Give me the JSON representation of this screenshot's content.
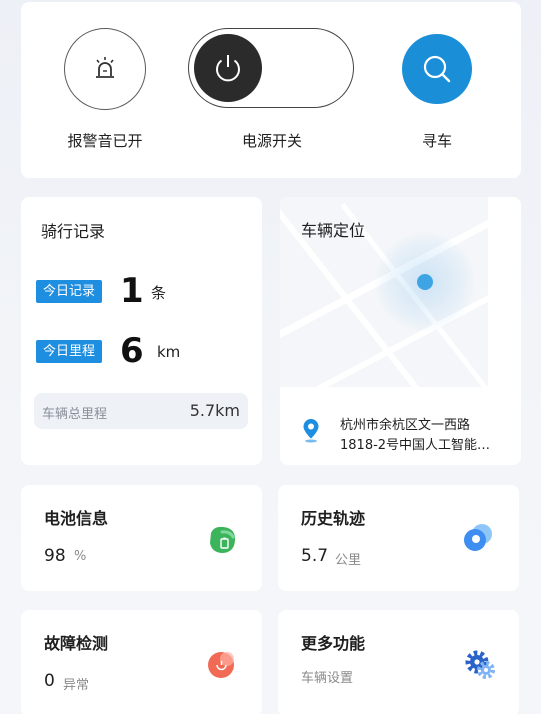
{
  "controls": {
    "alarm_label": "报警音已开",
    "power_label": "电源开关",
    "find_label": "寻车"
  },
  "ride": {
    "title": "骑行记录",
    "today_records_tag": "今日记录",
    "today_records_value": "1",
    "today_records_unit": "条",
    "today_mileage_tag": "今日里程",
    "today_mileage_value": "6",
    "today_mileage_unit": "km",
    "total_label": "车辆总里程",
    "total_value": "5.7km"
  },
  "location": {
    "title": "车辆定位",
    "address_line1": "杭州市余杭区文一西路",
    "address_line2": "1818-2号中国人工智能…"
  },
  "battery": {
    "title": "电池信息",
    "value": "98",
    "unit": "%"
  },
  "history": {
    "title": "历史轨迹",
    "value": "5.7",
    "unit": "公里"
  },
  "fault": {
    "title": "故障检测",
    "value": "0",
    "unit": "异常"
  },
  "more": {
    "title": "更多功能",
    "subtitle": "车辆设置"
  },
  "colors": {
    "accent_blue": "#1d8ee0",
    "find_button": "#1a8fd8",
    "battery_green": "#3cb45c",
    "fault_red": "#f06a55",
    "history_blue": "#3d8ef0"
  }
}
